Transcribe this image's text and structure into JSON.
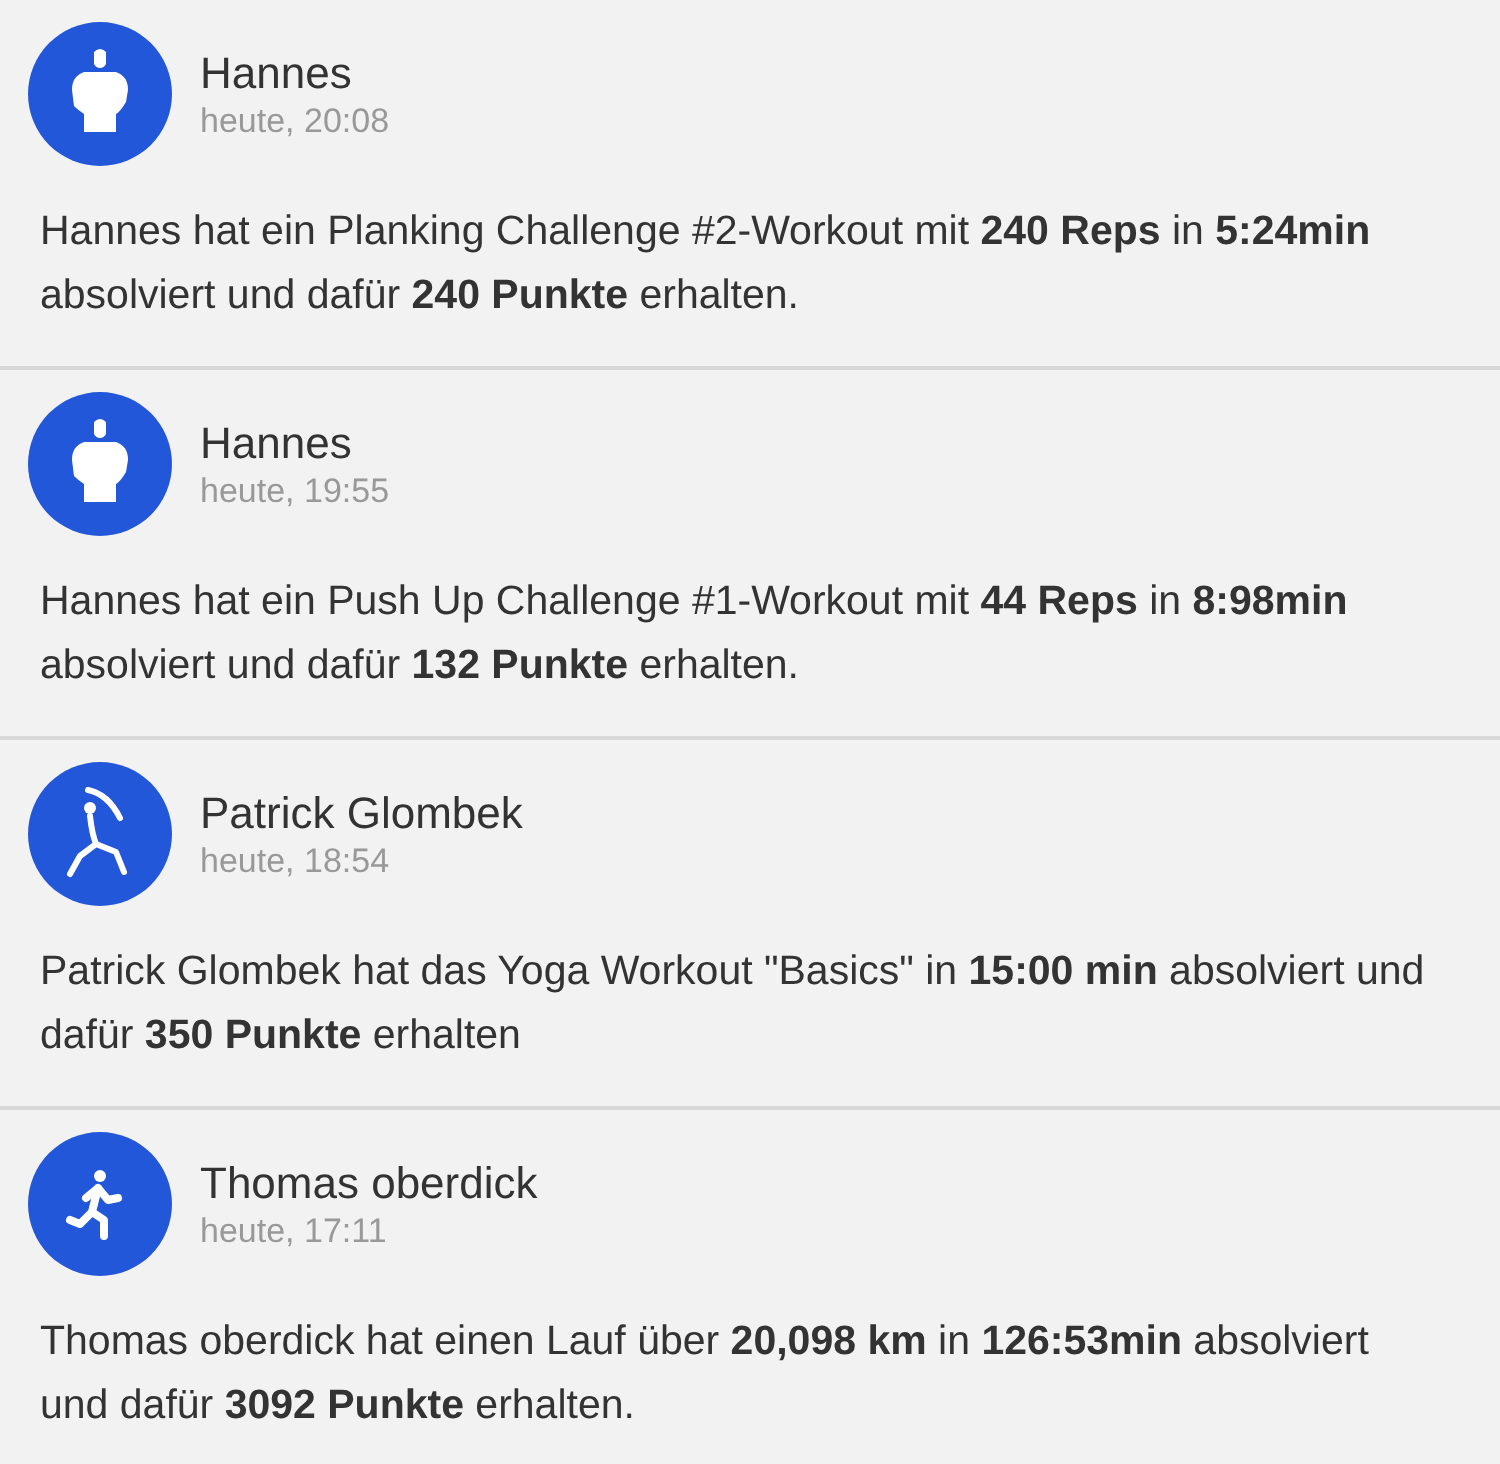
{
  "feed": [
    {
      "kind": "torso",
      "name": "Hannes",
      "time": "heute, 20:08",
      "text": "Hannes hat ein Planking Challenge #2-Workout mit **240 Reps** in **5:24min** absolviert und dafür **240 Punkte** erhalten."
    },
    {
      "kind": "torso",
      "name": "Hannes",
      "time": "heute, 19:55",
      "text": "Hannes hat ein Push Up Challenge #1-Workout mit **44 Reps** in **8:98min** absolviert und dafür **132 Punkte** erhalten."
    },
    {
      "kind": "yoga",
      "name": "Patrick Glombek",
      "time": "heute, 18:54",
      "text": "Patrick Glombek hat das Yoga Workout \"Basics\" in **15:00 min** absolviert und dafür **350 Punkte** erhalten"
    },
    {
      "kind": "run",
      "name": "Thomas oberdick",
      "time": "heute, 17:11",
      "text": "Thomas oberdick hat einen Lauf über **20,098 km** in **126:53min** absolviert und dafür **3092 Punkte** erhalten."
    }
  ]
}
